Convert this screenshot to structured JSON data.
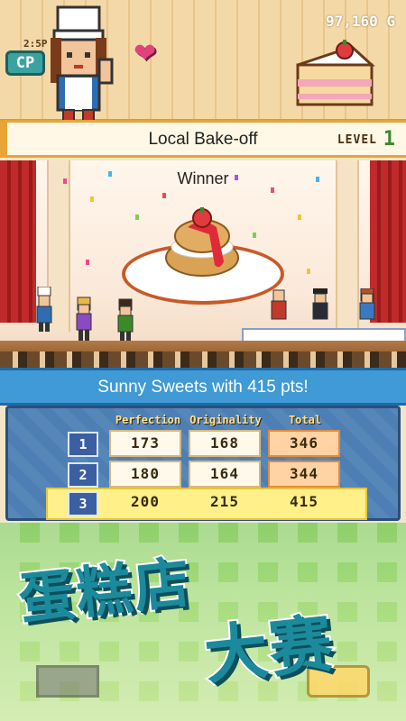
{
  "hud": {
    "money": "97,160 G",
    "time": "2:5P",
    "cp_label": "CP"
  },
  "contest": {
    "name": "Local Bake-off",
    "level_label": "LEVEL",
    "level_value": "1"
  },
  "stage": {
    "winner_label": "Winner"
  },
  "result": {
    "text": "Sunny Sweets with 415 pts!"
  },
  "scores": {
    "headers": [
      "Perfection",
      "Originality",
      "Total"
    ],
    "rows": [
      {
        "rank": "1",
        "perfection": "173",
        "originality": "168",
        "total": "346"
      },
      {
        "rank": "2",
        "perfection": "180",
        "originality": "164",
        "total": "344"
      },
      {
        "rank": "3",
        "perfection": "200",
        "originality": "215",
        "total": "415"
      }
    ]
  },
  "promo": {
    "line1": "蛋糕店",
    "line2": "大赛"
  },
  "colors": {
    "accent_gold": "#e7a437",
    "banner_blue": "#3f9ad6",
    "highlight_row": "#fff08a",
    "title_teal": "#1b8a9c"
  }
}
